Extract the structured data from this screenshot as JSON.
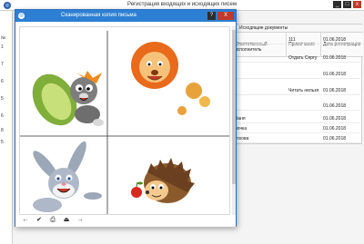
{
  "main_window": {
    "title": "Регистрация входящих и исходящих писем",
    "app_icon": "app-icon",
    "controls": {
      "minimize": "_",
      "maximize": "□",
      "close": "x"
    },
    "left_strip_rows": [
      "№",
      "1",
      "7",
      "6",
      "5",
      "6",
      "8",
      "5"
    ]
  },
  "grid": {
    "group_header": "Исходящие документы",
    "columns": [
      "Ответственный исполнитель",
      "Примечание",
      "Дата регистрации"
    ],
    "rows": [
      {
        "executor": "",
        "note": "111",
        "date": "01.06.2018"
      },
      {
        "executor": "",
        "note": "Отдать Сергу",
        "date": "01.06.2018"
      },
      {
        "executor": "",
        "note": "",
        "date": "01.06.2018"
      },
      {
        "executor": "",
        "note": "Читать нельзя",
        "date": "01.06.2018"
      },
      {
        "executor": "",
        "note": "",
        "date": "01.06.2018"
      },
      {
        "executor": "Ваня",
        "note": "",
        "date": "01.06.2018"
      },
      {
        "executor": "рочка",
        "note": "",
        "date": "01.06.2018"
      },
      {
        "executor": "ускова",
        "note": "",
        "date": "01.06.2018"
      }
    ]
  },
  "dialog": {
    "title": "Сканированная копия письма",
    "help_label": "?",
    "close_label": "X",
    "toolbar": [
      {
        "icon": "arrow-left-icon",
        "glyph": "←"
      },
      {
        "icon": "checkmark-icon",
        "glyph": "✔"
      },
      {
        "icon": "printer-icon",
        "glyph": "⎙"
      },
      {
        "icon": "scanner-icon",
        "glyph": "⏏"
      },
      {
        "icon": "arrow-right-icon",
        "glyph": "→"
      }
    ]
  },
  "colors": {
    "dialog_title_bg": "#2d7fd3",
    "close_button": "#c0392b"
  }
}
